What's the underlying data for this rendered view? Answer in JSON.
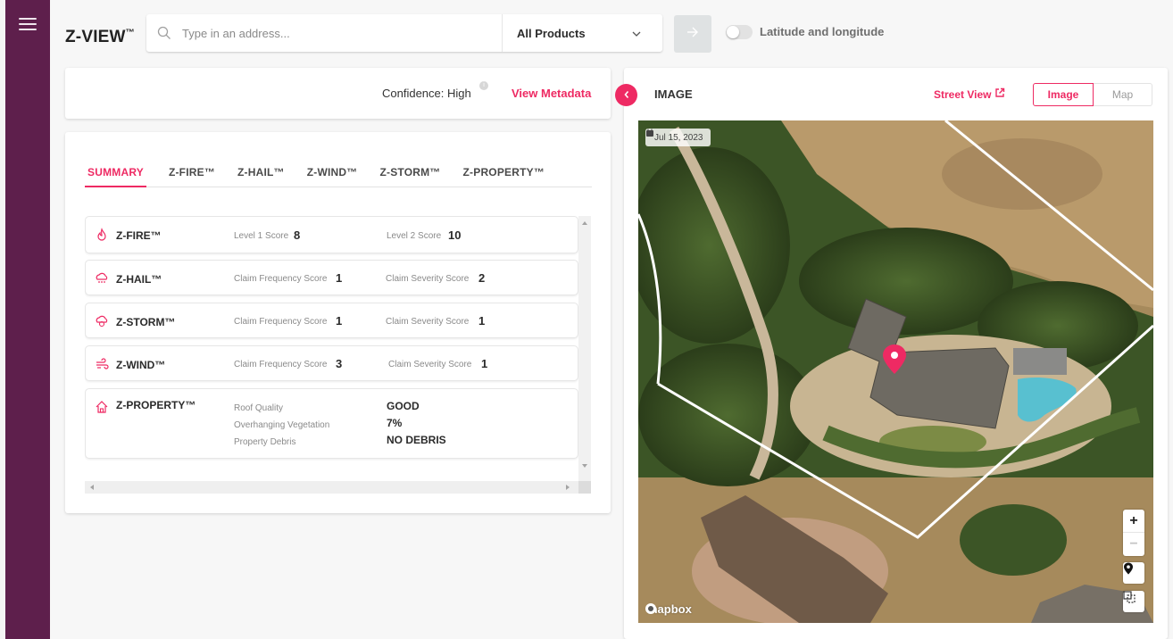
{
  "app": {
    "brand": "Z-VIEW",
    "brand_mark": "™"
  },
  "colors": {
    "sidebar": "#5e1f4c",
    "accent": "#ee2a63"
  },
  "search": {
    "placeholder": "Type in an address...",
    "value": "",
    "product_selected": "All Products",
    "go_icon": "arrow-right-icon"
  },
  "latlng_toggle": {
    "label": "Latitude and longitude",
    "on": false
  },
  "confidence": {
    "text": "Confidence: High",
    "info_icon": "info-icon",
    "view_metadata": "View Metadata"
  },
  "summary": {
    "tabs": [
      {
        "label": "SUMMARY",
        "active": true
      },
      {
        "label": "Z-FIRE™",
        "active": false
      },
      {
        "label": "Z-HAIL™",
        "active": false
      },
      {
        "label": "Z-WIND™",
        "active": false
      },
      {
        "label": "Z-STORM™",
        "active": false
      },
      {
        "label": "Z-PROPERTY™",
        "active": false
      }
    ],
    "cards": [
      {
        "title": "Z-FIRE™",
        "icon": "fire-icon",
        "metrics": [
          {
            "label": "Level 1 Score",
            "value": "8"
          },
          {
            "label": "Level 2 Score",
            "value": "10"
          }
        ]
      },
      {
        "title": "Z-HAIL™",
        "icon": "hail-icon",
        "metrics": [
          {
            "label": "Claim Frequency Score",
            "value": "1"
          },
          {
            "label": "Claim Severity Score",
            "value": "2"
          }
        ]
      },
      {
        "title": "Z-STORM™",
        "icon": "storm-icon",
        "metrics": [
          {
            "label": "Claim Frequency Score",
            "value": "1"
          },
          {
            "label": "Claim Severity Score",
            "value": "1"
          }
        ]
      },
      {
        "title": "Z-WIND™",
        "icon": "wind-icon",
        "metrics": [
          {
            "label": "Claim Frequency Score",
            "value": "3"
          },
          {
            "label": "Claim Severity Score",
            "value": "1"
          }
        ]
      },
      {
        "title": "Z-PROPERTY™",
        "icon": "house-icon",
        "properties": [
          {
            "label": "Roof Quality",
            "value": "GOOD"
          },
          {
            "label": "Overhanging Vegetation",
            "value": "7%"
          },
          {
            "label": "Property Debris",
            "value": "NO DEBRIS"
          }
        ]
      }
    ]
  },
  "image_panel": {
    "title": "IMAGE",
    "street_view": "Street View",
    "view_options": [
      "Image",
      "Map"
    ],
    "selected_view": "Image",
    "capture_date": "Jul 15, 2023",
    "attribution": "mapbox",
    "zoom_in": "+",
    "zoom_out": "−"
  }
}
